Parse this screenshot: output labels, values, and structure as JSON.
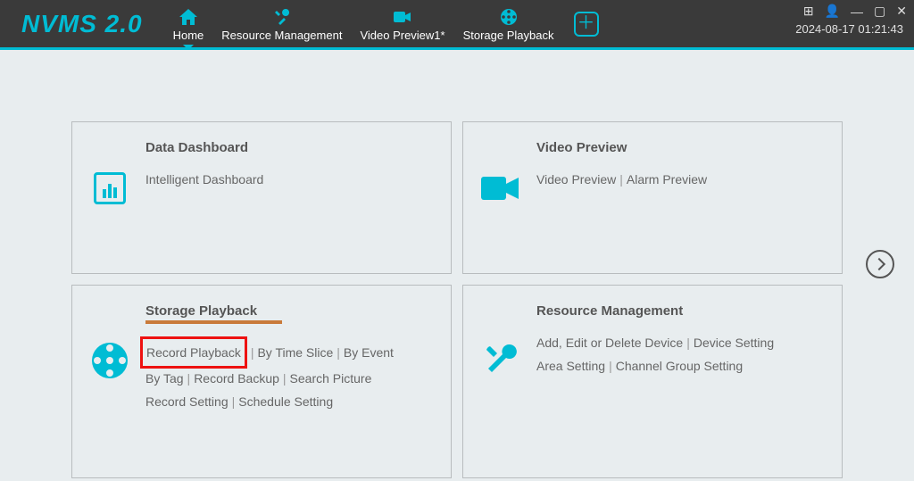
{
  "app": {
    "name": "NVMS 2.0",
    "timestamp": "2024-08-17 01:21:43"
  },
  "tabs": [
    {
      "label": "Home",
      "icon": "home",
      "active": true
    },
    {
      "label": "Resource Management",
      "icon": "tools"
    },
    {
      "label": "Video Preview1*",
      "icon": "camera"
    },
    {
      "label": "Storage Playback",
      "icon": "reel"
    }
  ],
  "addTab": "＋",
  "nav": {
    "grid": "⊞",
    "user": "👤",
    "min": "—",
    "max": "▢",
    "close": "✕"
  },
  "cards": {
    "dashboard": {
      "title": "Data Dashboard",
      "links": [
        "Intelligent Dashboard"
      ]
    },
    "preview": {
      "title": "Video Preview",
      "links": [
        "Video Preview",
        "Alarm Preview"
      ]
    },
    "playback": {
      "title": "Storage Playback",
      "links": [
        "Record Playback",
        "By Time Slice",
        "By Event",
        "By Tag",
        "Record Backup",
        "Search Picture",
        "Record Setting",
        "Schedule Setting"
      ]
    },
    "resource": {
      "title": "Resource Management",
      "links": [
        "Add, Edit or Delete Device",
        "Device Setting",
        "Area Setting",
        "Channel Group Setting"
      ]
    }
  }
}
